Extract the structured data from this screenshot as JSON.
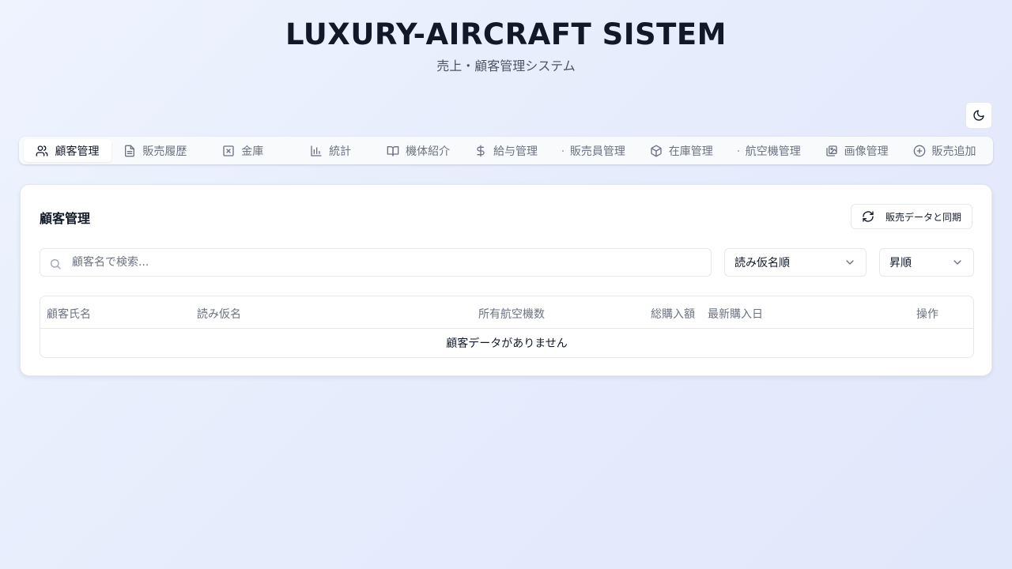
{
  "header": {
    "title": "LUXURY-AIRCRAFT SISTEM",
    "subtitle": "売上・顧客管理システム"
  },
  "theme_toggle": {
    "icon": "moon-icon"
  },
  "tabs": [
    {
      "label": "顧客管理",
      "icon": "users-icon",
      "active": true
    },
    {
      "label": "販売履歴",
      "icon": "file-text-icon",
      "active": false
    },
    {
      "label": "金庫",
      "icon": "square-x-icon",
      "active": false
    },
    {
      "label": "統計",
      "icon": "bar-chart-icon",
      "active": false
    },
    {
      "label": "機体紹介",
      "icon": "book-open-icon",
      "active": false
    },
    {
      "label": "給与管理",
      "icon": "dollar-icon",
      "active": false
    },
    {
      "label": "販売員管理",
      "icon": "dot-icon",
      "active": false
    },
    {
      "label": "在庫管理",
      "icon": "package-icon",
      "active": false
    },
    {
      "label": "航空機管理",
      "icon": "dot-icon",
      "active": false
    },
    {
      "label": "画像管理",
      "icon": "images-icon",
      "active": false
    },
    {
      "label": "販売追加",
      "icon": "plus-circle-icon",
      "active": false
    }
  ],
  "main": {
    "title": "顧客管理",
    "sync_button": "販売データと同期",
    "search": {
      "placeholder": "顧客名で検索...",
      "value": ""
    },
    "sort_key": {
      "selected": "読み仮名順"
    },
    "sort_dir": {
      "selected": "昇順"
    },
    "table": {
      "columns": [
        "顧客氏名",
        "読み仮名",
        "所有航空機数",
        "総購入額",
        "最新購入日",
        "操作"
      ],
      "rows": [],
      "empty_message": "顧客データがありません"
    }
  },
  "colors": {
    "text_primary": "#111827",
    "text_muted": "#6b7280",
    "border": "#e5e7eb",
    "background": "#eef3fe"
  }
}
